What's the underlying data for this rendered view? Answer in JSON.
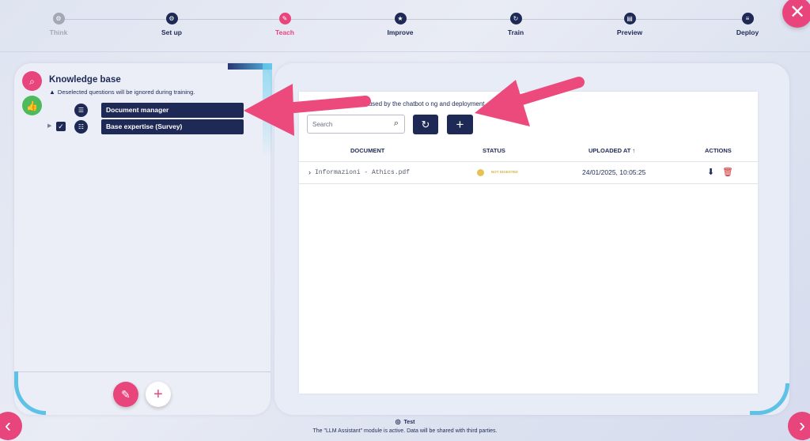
{
  "stepper": {
    "steps": [
      {
        "label": "Think",
        "icon": "⚙"
      },
      {
        "label": "Set up",
        "icon": "⚙"
      },
      {
        "label": "Teach",
        "icon": "✎"
      },
      {
        "label": "Improve",
        "icon": "★"
      },
      {
        "label": "Train",
        "icon": "↻"
      },
      {
        "label": "Preview",
        "icon": "▤"
      },
      {
        "label": "Deploy",
        "icon": "≡"
      }
    ],
    "active_step": "Teach"
  },
  "window": {
    "close_icon": "✕",
    "prev_icon": "‹",
    "next_icon": "›"
  },
  "sidebar": {
    "search_icon": "⌕",
    "thumb_icon": "👍",
    "title": "Knowledge base",
    "warning_icon": "▲",
    "warning": "Deselected questions will be ignored during training.",
    "items": [
      {
        "label": "Document manager",
        "icon": "☰",
        "checked": false,
        "expandable": false
      },
      {
        "label": "Base expertise (Survey)",
        "icon": "☷",
        "checked": true,
        "expandable": true,
        "expand_icon": "▶",
        "check_icon": "✓"
      }
    ],
    "edit_icon": "✎",
    "add_icon": "+"
  },
  "main": {
    "info_text": "ded documents are used by the chatbot o                                    ng and deployment.",
    "search": {
      "placeholder": "Search",
      "value": "",
      "icon": "⌕"
    },
    "refresh_icon": "↻",
    "add_icon": "+",
    "table": {
      "columns": [
        "DOCUMENT",
        "STATUS",
        "UPLOADED AT ↑",
        "ACTIONS"
      ],
      "rows": [
        {
          "expand_icon": "›",
          "document": "Informazioni - Athics.pdf",
          "status": "NOT DIGESTED",
          "status_color": "#e6c252",
          "uploaded_at": "24/01/2025, 10:05:25",
          "download_icon": "⬇",
          "delete_icon": "🗑"
        }
      ]
    }
  },
  "footer": {
    "globe_icon": "◎",
    "mode": "Test",
    "note": "The \"LLM Assistant\" module is active. Data will be shared with third parties."
  },
  "colors": {
    "navy": "#1e2a55",
    "accent_pink": "#e8457d",
    "success_green": "#4dbb5c",
    "status_yellow": "#e6c252",
    "delete_red": "#c62828",
    "arrow_pink": "#ec4a7c"
  }
}
